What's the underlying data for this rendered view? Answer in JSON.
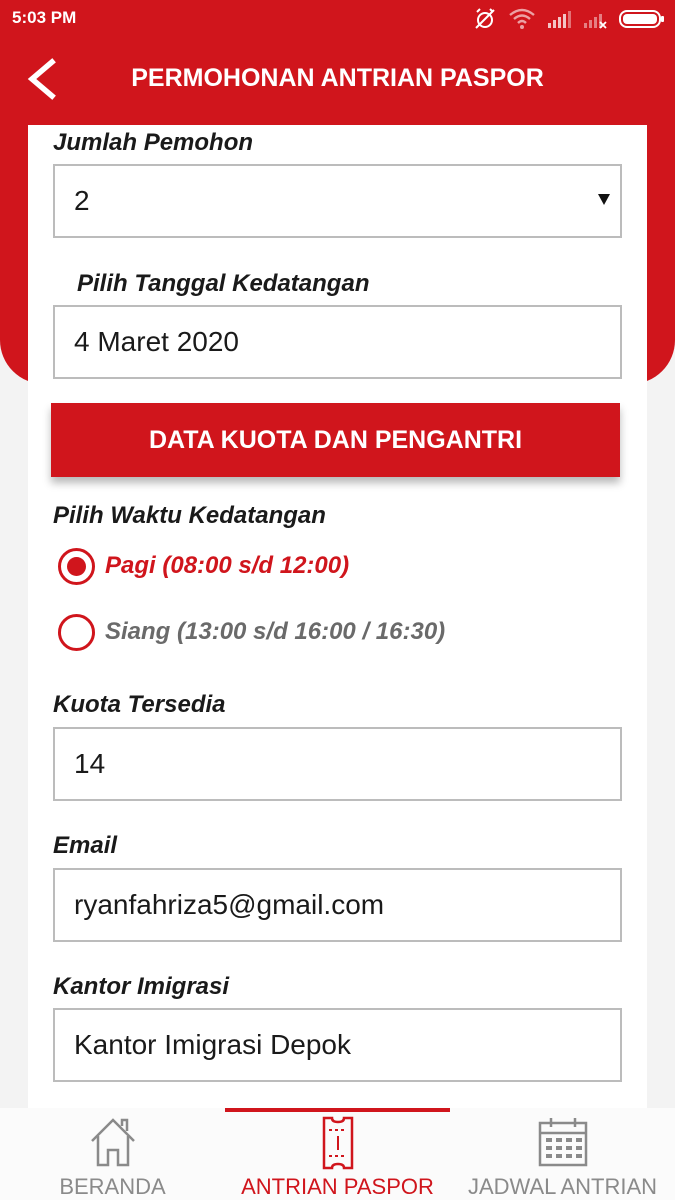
{
  "status_bar": {
    "time": "5:03 PM"
  },
  "header": {
    "title": "PERMOHONAN ANTRIAN PASPOR"
  },
  "form": {
    "jumlah_pemohon": {
      "label": "Jumlah Pemohon",
      "value": "2"
    },
    "tanggal": {
      "label": "Pilih Tanggal Kedatangan",
      "value": "4 Maret 2020"
    },
    "data_button": "DATA KUOTA DAN PENGANTRI",
    "waktu": {
      "label": "Pilih Waktu Kedatangan",
      "options": [
        {
          "label": "Pagi (08:00 s/d 12:00)",
          "selected": true
        },
        {
          "label": "Siang (13:00 s/d 16:00 / 16:30)",
          "selected": false
        }
      ]
    },
    "kuota": {
      "label": "Kuota Tersedia",
      "value": "14"
    },
    "email": {
      "label": "Email",
      "value": "ryanfahriza5@gmail.com"
    },
    "kantor": {
      "label": "Kantor Imigrasi",
      "value": "Kantor Imigrasi Depok"
    }
  },
  "bottom_nav": {
    "items": [
      {
        "label": "BERANDA",
        "icon": "home-icon",
        "active": false
      },
      {
        "label": "ANTRIAN PASPOR",
        "icon": "ticket-icon",
        "active": true
      },
      {
        "label": "JADWAL ANTRIAN",
        "icon": "calendar-icon",
        "active": false
      }
    ]
  },
  "colors": {
    "accent": "#d0151c",
    "background": "#f3f3f3"
  }
}
